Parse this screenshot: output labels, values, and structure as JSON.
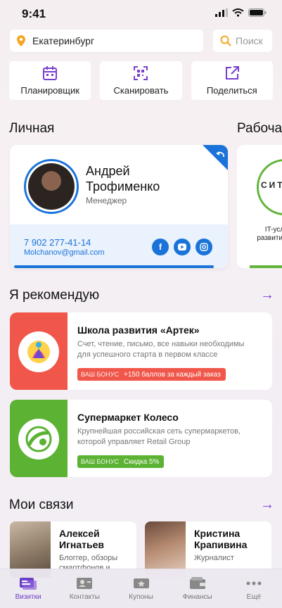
{
  "status": {
    "time": "9:41"
  },
  "search": {
    "city": "Екатеринбург",
    "placeholder": "Поиск"
  },
  "actions": [
    {
      "label": "Планировщик",
      "icon": "calendar-icon"
    },
    {
      "label": "Сканировать",
      "icon": "qr-scan-icon"
    },
    {
      "label": "Поделиться",
      "icon": "share-icon"
    }
  ],
  "sections": {
    "personal": "Личная",
    "work": "Рабоча",
    "recommend": "Я рекомендую",
    "connections": "Мои связи"
  },
  "personal_card": {
    "first_name": "Андрей",
    "last_name": "Трофименко",
    "role": "Менеджер",
    "phone": "7 902 277-41-14",
    "email": "Molchanov@gmail.com",
    "socials": [
      "facebook-icon",
      "youtube-icon",
      "instagram-icon"
    ]
  },
  "work_card": {
    "logo_text": "СИТ",
    "desc": "IT-услу развити биз"
  },
  "recommendations": [
    {
      "title": "Школа развития «Артек»",
      "desc": "Счет, чтение, письмо, все навыки необходимы для успешного старта в первом классе",
      "bonus_tag": "ВАШ БОНУС",
      "bonus_value": "+150 баллов за каждый заказ",
      "color": "#f0564a"
    },
    {
      "title": "Супермаркет Колесо",
      "desc": "Крупнейшая российская сеть супермаркетов, которой управляет Retail Group",
      "bonus_tag": "ВАШ БОНУС",
      "bonus_value": "Скидка 5%",
      "color": "#5bb233"
    }
  ],
  "connections": [
    {
      "name": "Алексей Игнатьев",
      "desc": "Блоггер, обзоры смартфонов и"
    },
    {
      "name": "Кристина Крапивина",
      "desc": "Журналист"
    }
  ],
  "tabs": [
    {
      "label": "Визитки",
      "active": true
    },
    {
      "label": "Контакты",
      "active": false
    },
    {
      "label": "Купоны",
      "active": false
    },
    {
      "label": "Финансы",
      "active": false
    },
    {
      "label": "Ещё",
      "active": false
    }
  ],
  "colors": {
    "accent": "#6c3fc9",
    "primary": "#1a73d9",
    "pin": "#f5a623"
  }
}
